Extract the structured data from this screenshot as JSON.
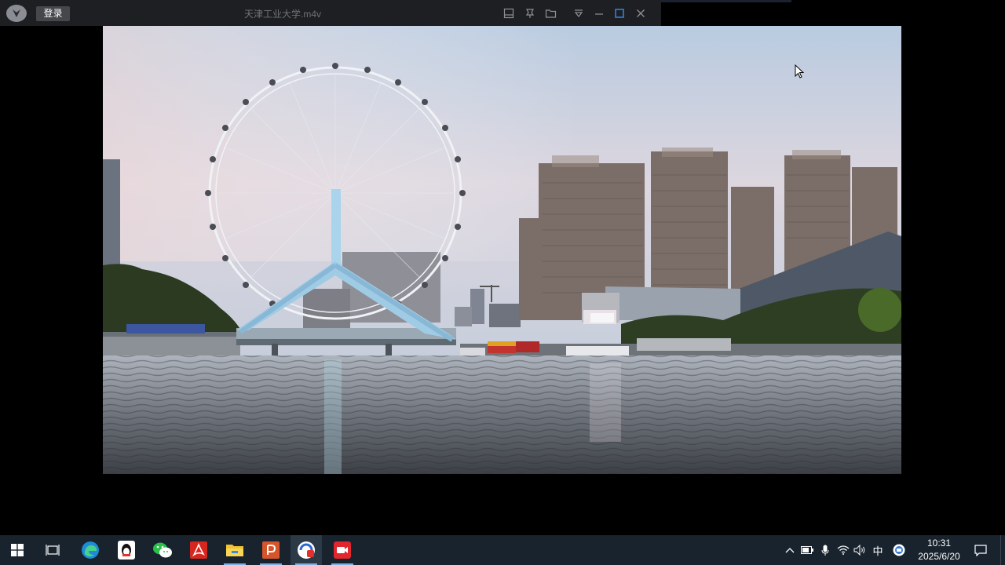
{
  "player": {
    "login_label": "登录",
    "file_title": "天津工业大学.m4v",
    "icons": [
      "app-logo-icon",
      "compact-mode-icon",
      "pin-icon",
      "open-folder-icon",
      "menu-dropdown-icon",
      "minimize-icon",
      "maximize-icon",
      "close-icon"
    ]
  },
  "taskbar": {
    "apps": [
      "windows-start-icon",
      "task-view-icon",
      "edge-icon",
      "qq-icon",
      "wechat-icon",
      "acrobat-icon",
      "file-explorer-icon",
      "powerpoint-icon",
      "video-player-icon",
      "screen-recorder-icon"
    ],
    "tray": {
      "ime_label": "中",
      "time": "10:31",
      "date": "2025/6/20"
    }
  },
  "colors": {
    "titlebar_bg": "#1e1f22",
    "taskbar_bg": "#18232e",
    "active_underline": "#7fb0e3"
  }
}
